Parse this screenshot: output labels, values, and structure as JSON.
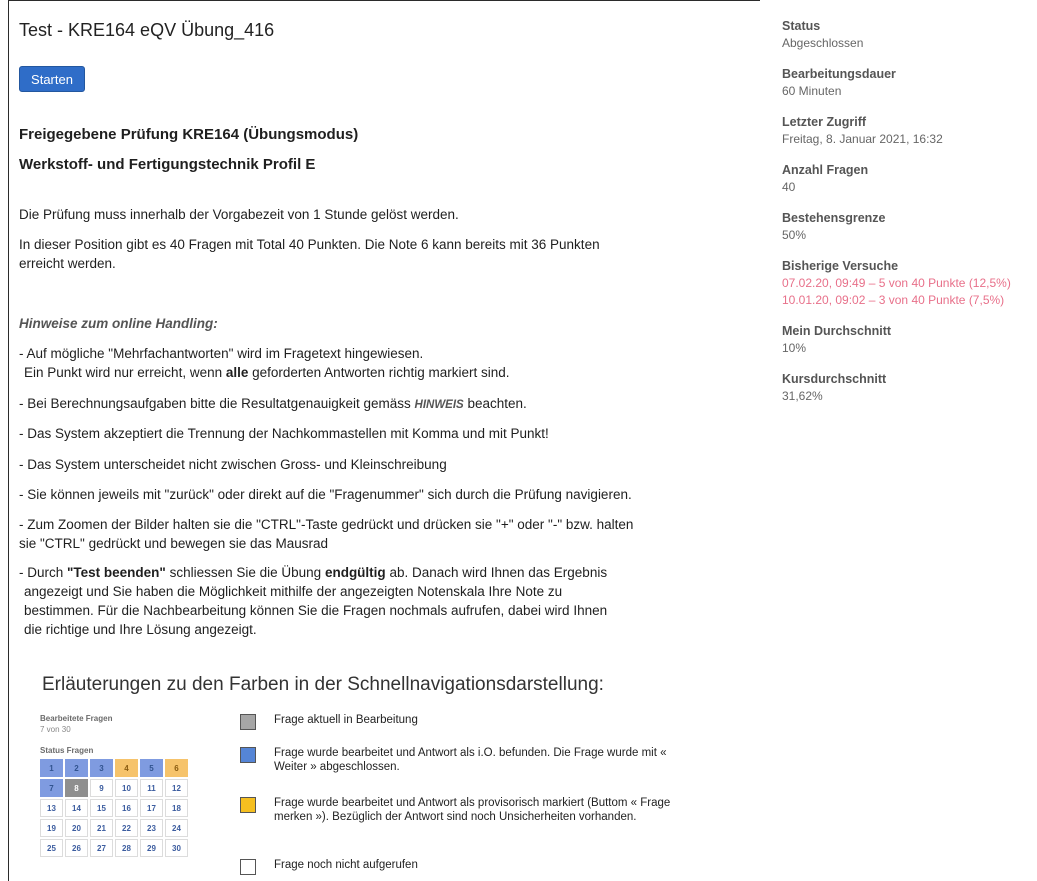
{
  "title": "Test - KRE164 eQV Übung_416",
  "start_button": "Starten",
  "heading1": "Freigegebene Prüfung KRE164 (Übungsmodus)",
  "heading2": "Werkstoff- und Fertigungstechnik Profil E",
  "intro1": "Die Prüfung muss innerhalb der Vorgabezeit von 1 Stunde gelöst werden.",
  "intro2_line1": "In dieser Position gibt es 40 Fragen mit Total 40 Punkten. Die Note 6 kann bereits mit 36 Punkten",
  "intro2_line2": "erreicht werden.",
  "hints_heading": "Hinweise zum online Handling:",
  "b1_line1": "- Auf mögliche \"Mehrfachantworten\" wird im Fragetext hingewiesen.",
  "b1_line2_pre": "Ein Punkt wird nur erreicht, wenn ",
  "b1_line2_bold": "alle",
  "b1_line2_post": " geforderten Antworten richtig markiert sind.",
  "b2_pre": "- Bei Berechnungsaufgaben bitte die Resultatgenauigkeit gemäss ",
  "b2_hinweis": "HINWEIS",
  "b2_post": " beachten.",
  "b3": "- Das System akzeptiert die Trennung der Nachkommastellen mit Komma und mit Punkt!",
  "b4": "- Das System unterscheidet nicht zwischen Gross- und Kleinschreibung",
  "b5": "- Sie können jeweils mit \"zurück\" oder direkt auf die \"Fragenummer\" sich durch die Prüfung navigieren.",
  "b6_line1": "- Zum Zoomen der Bilder halten sie die \"CTRL\"-Taste gedrückt und drücken sie \"+\" oder \"-\" bzw. halten",
  "b6_line2": "sie \"CTRL\" gedrückt und bewegen sie das Mausrad",
  "b7_pre": "- Durch ",
  "b7_bold1": "\"Test beenden\"",
  "b7_mid": " schliessen Sie die Übung ",
  "b7_bold2": "endgültig",
  "b7_post": " ab. Danach wird Ihnen das Ergebnis",
  "b7_line2": "angezeigt und  Sie haben die Möglichkeit mithilfe der angezeigten Notenskala Ihre Note zu",
  "b7_line3": "bestimmen. Für die Nachbearbeitung  können Sie die Fragen nochmals aufrufen, dabei wird Ihnen",
  "b7_line4": "die richtige und Ihre Lösung angezeigt.",
  "caption": "Erläuterungen zu den Farben in der Schnellnavigationsdarstellung:",
  "mini": {
    "label": "Bearbeitete Fragen",
    "sub": "7 von 30",
    "status_label": "Status Fragen",
    "cells": [
      {
        "n": "1",
        "state": "blue"
      },
      {
        "n": "2",
        "state": "blue"
      },
      {
        "n": "3",
        "state": "blue"
      },
      {
        "n": "4",
        "state": "orange"
      },
      {
        "n": "5",
        "state": "blue"
      },
      {
        "n": "6",
        "state": "orange"
      },
      {
        "n": "7",
        "state": "blue"
      },
      {
        "n": "8",
        "state": "gray"
      },
      {
        "n": "9",
        "state": "none"
      },
      {
        "n": "10",
        "state": "none"
      },
      {
        "n": "11",
        "state": "none"
      },
      {
        "n": "12",
        "state": "none"
      },
      {
        "n": "13",
        "state": "none"
      },
      {
        "n": "14",
        "state": "none"
      },
      {
        "n": "15",
        "state": "none"
      },
      {
        "n": "16",
        "state": "none"
      },
      {
        "n": "17",
        "state": "none"
      },
      {
        "n": "18",
        "state": "none"
      },
      {
        "n": "19",
        "state": "none"
      },
      {
        "n": "20",
        "state": "none"
      },
      {
        "n": "21",
        "state": "none"
      },
      {
        "n": "22",
        "state": "none"
      },
      {
        "n": "23",
        "state": "none"
      },
      {
        "n": "24",
        "state": "none"
      },
      {
        "n": "25",
        "state": "none"
      },
      {
        "n": "26",
        "state": "none"
      },
      {
        "n": "27",
        "state": "none"
      },
      {
        "n": "28",
        "state": "none"
      },
      {
        "n": "29",
        "state": "none"
      },
      {
        "n": "30",
        "state": "none"
      }
    ]
  },
  "legend": [
    {
      "color": "#a6a6a6",
      "text": "Frage aktuell in Bearbeitung"
    },
    {
      "color": "#5585d6",
      "text": "Frage wurde bearbeitet und Antwort als i.O. befunden.  Die Frage wurde mit « Weiter » abgeschlossen."
    },
    {
      "color": "#f5bf20",
      "text": "Frage wurde bearbeitet und Antwort als provisorisch markiert (Buttom « Frage merken »). Bezüglich der Antwort sind noch Unsicherheiten vorhanden."
    },
    {
      "color": "#ffffff",
      "text": "Frage noch nicht aufgerufen"
    }
  ],
  "sidebar": {
    "status_label": "Status",
    "status_value": "Abgeschlossen",
    "duration_label": "Bearbeitungsdauer",
    "duration_value": "60 Minuten",
    "last_label": "Letzter Zugriff",
    "last_value": "Freitag, 8. Januar 2021, 16:32",
    "questions_label": "Anzahl Fragen",
    "questions_value": "40",
    "pass_label": "Bestehensgrenze",
    "pass_value": "50%",
    "attempts_label": "Bisherige Versuche",
    "attempt1": "07.02.20, 09:49 – 5 von 40 Punkte (12,5%)",
    "attempt2": "10.01.20, 09:02 – 3 von 40 Punkte (7,5%)",
    "avg_label": "Mein Durchschnitt",
    "avg_value": "10%",
    "course_label": "Kursdurchschnitt",
    "course_value": "31,62%"
  }
}
